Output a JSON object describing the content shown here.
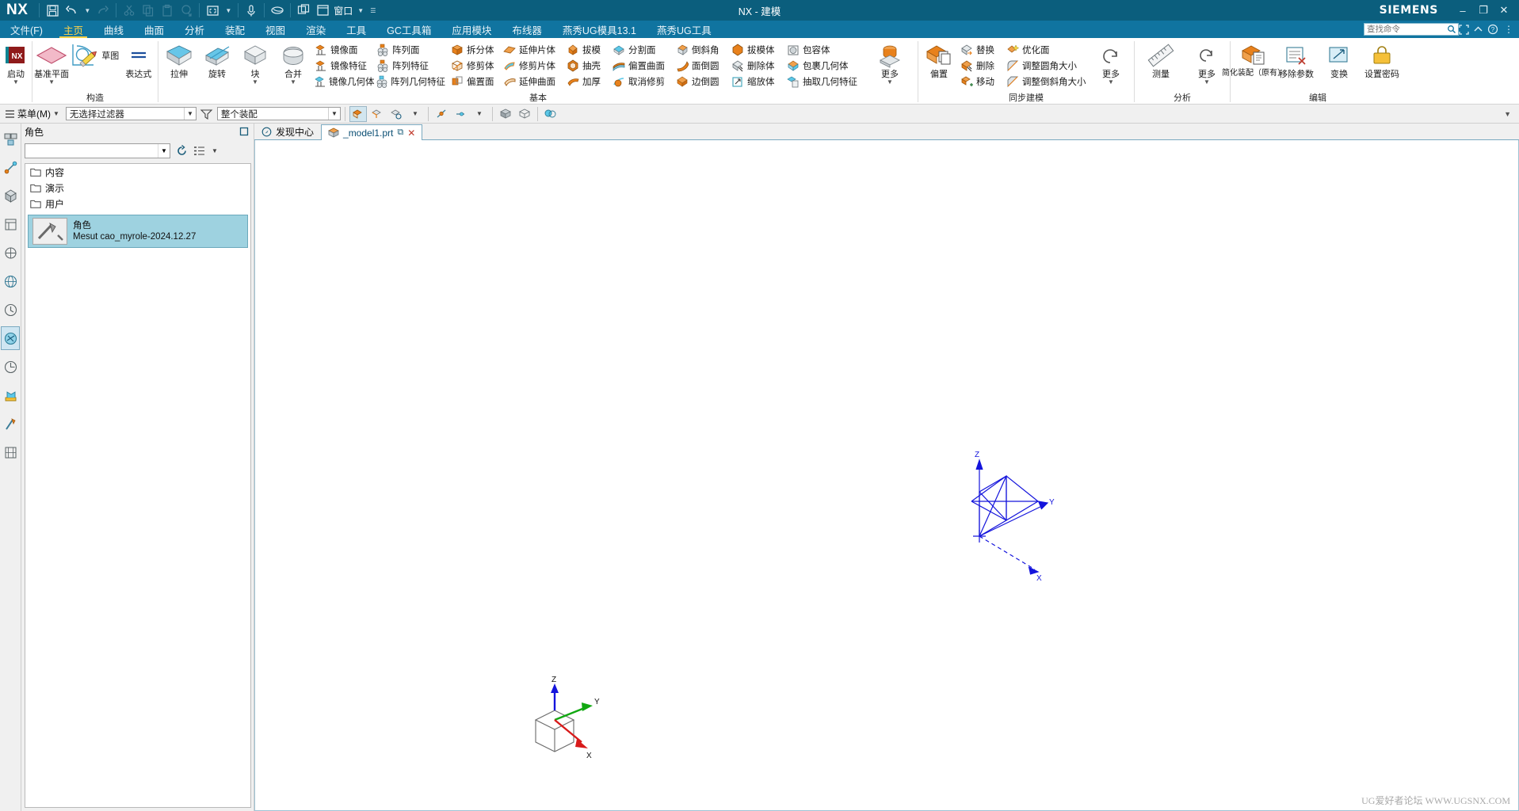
{
  "window": {
    "title": "NX - 建模",
    "brand": "SIEMENS",
    "logo": "NX",
    "controls": {
      "minimize": "–",
      "maximize": "❐",
      "close": "✕"
    }
  },
  "quickaccess": {
    "items": [
      {
        "name": "save-icon",
        "label": "保存"
      },
      {
        "name": "undo-icon",
        "label": "撤销"
      },
      {
        "name": "redo-icon",
        "label": "重做"
      },
      {
        "name": "cut-icon",
        "label": "剪切"
      },
      {
        "name": "copy-icon",
        "label": "复制"
      },
      {
        "name": "paste-icon",
        "label": "粘贴"
      },
      {
        "name": "transform-icon",
        "label": "变换"
      },
      {
        "name": "fit-window-icon",
        "label": "适合窗口"
      },
      {
        "name": "voice-icon",
        "label": "语音"
      },
      {
        "name": "eraser-icon",
        "label": "擦除"
      },
      {
        "name": "tile-windows-icon",
        "label": "平铺窗口"
      },
      {
        "name": "window-icon",
        "label": "窗口"
      }
    ],
    "window_label": "窗口"
  },
  "menubar": {
    "tabs": [
      {
        "label": "文件(F)",
        "active": false
      },
      {
        "label": "主页",
        "active": true
      },
      {
        "label": "曲线",
        "active": false
      },
      {
        "label": "曲面",
        "active": false
      },
      {
        "label": "分析",
        "active": false
      },
      {
        "label": "装配",
        "active": false
      },
      {
        "label": "视图",
        "active": false
      },
      {
        "label": "渲染",
        "active": false
      },
      {
        "label": "工具",
        "active": false
      },
      {
        "label": "GC工具箱",
        "active": false
      },
      {
        "label": "应用模块",
        "active": false
      },
      {
        "label": "布线器",
        "active": false
      },
      {
        "label": "燕秀UG模具13.1",
        "active": false
      },
      {
        "label": "燕秀UG工具",
        "active": false
      }
    ],
    "search": {
      "placeholder": "查找命令",
      "value": ""
    }
  },
  "ribbon": {
    "groups": [
      {
        "title": "",
        "big": [
          {
            "label": "启动",
            "icon": "nx-launch-icon",
            "dropdown": true
          }
        ]
      },
      {
        "title": "构造",
        "big": [
          {
            "label": "基准平面",
            "icon": "datum-plane-icon",
            "dropdown": true
          },
          {
            "label": "草图",
            "icon": "sketch-icon",
            "dropdown": false
          },
          {
            "label": "表达式",
            "icon": "expression-icon",
            "dropdown": false
          }
        ]
      },
      {
        "title": "基本",
        "big": [
          {
            "label": "拉伸",
            "icon": "extrude-icon",
            "dropdown": false
          },
          {
            "label": "旋转",
            "icon": "revolve-icon",
            "dropdown": false
          },
          {
            "label": "块",
            "icon": "block-icon",
            "dropdown": true
          },
          {
            "label": "合并",
            "icon": "unite-icon",
            "dropdown": true
          }
        ],
        "columns": [
          [
            {
              "label": "镜像面",
              "icon": "mirror-face-icon"
            },
            {
              "label": "镜像特征",
              "icon": "mirror-feature-icon"
            },
            {
              "label": "镜像几何体",
              "icon": "mirror-geometry-icon"
            }
          ],
          [
            {
              "label": "阵列面",
              "icon": "pattern-face-icon"
            },
            {
              "label": "阵列特征",
              "icon": "pattern-feature-icon"
            },
            {
              "label": "阵列几何特征",
              "icon": "pattern-geometry-icon"
            }
          ],
          [
            {
              "label": "拆分体",
              "icon": "split-body-icon"
            },
            {
              "label": "修剪体",
              "icon": "trim-body-icon"
            },
            {
              "label": "偏置面",
              "icon": "offset-face-icon"
            }
          ],
          [
            {
              "label": "延伸片体",
              "icon": "extend-sheet-icon"
            },
            {
              "label": "修剪片体",
              "icon": "trim-sheet-icon"
            },
            {
              "label": "延伸曲面",
              "icon": "extend-surface-icon"
            }
          ],
          [
            {
              "label": "拔模",
              "icon": "draft-icon"
            },
            {
              "label": "抽壳",
              "icon": "shell-icon"
            },
            {
              "label": "加厚",
              "icon": "thicken-icon"
            }
          ],
          [
            {
              "label": "分割面",
              "icon": "divide-face-icon"
            },
            {
              "label": "偏置曲面",
              "icon": "offset-surface-icon"
            },
            {
              "label": "取消修剪",
              "icon": "untrim-icon"
            }
          ],
          [
            {
              "label": "倒斜角",
              "icon": "chamfer-icon"
            },
            {
              "label": "面倒圆",
              "icon": "face-blend-icon"
            },
            {
              "label": "边倒圆",
              "icon": "edge-blend-icon"
            }
          ],
          [
            {
              "label": "拔模体",
              "icon": "draft-body-icon"
            },
            {
              "label": "删除体",
              "icon": "delete-body-icon"
            },
            {
              "label": "缩放体",
              "icon": "scale-body-icon"
            }
          ],
          [
            {
              "label": "包容体",
              "icon": "bounding-body-icon"
            },
            {
              "label": "包裹几何体",
              "icon": "wrap-geometry-icon"
            },
            {
              "label": "抽取几何特征",
              "icon": "extract-geometry-icon"
            }
          ]
        ],
        "more": {
          "label": "更多",
          "icon": "more-basic-icon",
          "dropdown": true
        }
      },
      {
        "title": "同步建模",
        "big": [
          {
            "label": "偏置",
            "icon": "offset-region-icon",
            "dropdown": false
          }
        ],
        "columns": [
          [
            {
              "label": "替换",
              "icon": "replace-face-icon"
            },
            {
              "label": "删除",
              "icon": "delete-face-icon"
            },
            {
              "label": "移动",
              "icon": "move-face-icon"
            }
          ],
          [
            {
              "label": "优化面",
              "icon": "optimize-face-icon"
            },
            {
              "label": "调整圆角大小",
              "icon": "resize-blend-icon"
            },
            {
              "label": "调整倒斜角大小",
              "icon": "resize-chamfer-icon"
            }
          ]
        ],
        "more": {
          "label": "更多",
          "icon": "more-sync-icon",
          "dropdown": true
        }
      },
      {
        "title": "分析",
        "big": [
          {
            "label": "测量",
            "icon": "measure-icon",
            "dropdown": false
          }
        ],
        "more": {
          "label": "更多",
          "icon": "more-analysis-icon",
          "dropdown": true
        }
      },
      {
        "title": "编辑",
        "big": [
          {
            "label": "简化装配（原有）",
            "icon": "simplify-assembly-icon",
            "dropdown": false
          },
          {
            "label": "移除参数",
            "icon": "remove-parameters-icon",
            "dropdown": false
          },
          {
            "label": "变换",
            "icon": "transform-edit-icon",
            "dropdown": false
          },
          {
            "label": "设置密码",
            "icon": "set-password-icon",
            "dropdown": false
          }
        ]
      }
    ]
  },
  "selection_bar": {
    "menu_label": "菜单(M)",
    "filter": {
      "value": "无选择过滤器",
      "placeholder": ""
    },
    "scope": {
      "value": "整个装配",
      "placeholder": ""
    },
    "icons": [
      {
        "name": "selection-filter-icon"
      },
      {
        "name": "select-face-icon",
        "active": true
      },
      {
        "name": "select-edge-icon"
      },
      {
        "name": "select-feature-icon"
      },
      {
        "name": "snap-point-icon"
      },
      {
        "name": "snap-options-icon"
      },
      {
        "name": "shaded-view-icon"
      },
      {
        "name": "wireframe-view-icon"
      },
      {
        "name": "render-style-icon"
      }
    ]
  },
  "resource_bar": {
    "items": [
      {
        "name": "assembly-navigator-icon",
        "selected": false
      },
      {
        "name": "constraint-navigator-icon",
        "selected": false
      },
      {
        "name": "part-navigator-icon",
        "selected": false
      },
      {
        "name": "reuse-library-icon",
        "selected": false
      },
      {
        "name": "hd3d-tools-icon",
        "selected": false
      },
      {
        "name": "web-browser-icon",
        "selected": false
      },
      {
        "name": "history-icon",
        "selected": false
      },
      {
        "name": "role-icon",
        "selected": true
      },
      {
        "name": "system-materials-icon",
        "selected": false
      },
      {
        "name": "process-studio-icon",
        "selected": false
      },
      {
        "name": "manufacturing-wizards-icon",
        "selected": false
      },
      {
        "name": "mold-wizard-icon",
        "selected": false
      },
      {
        "name": "electrode-design-icon",
        "selected": false
      }
    ]
  },
  "nav_panel": {
    "title": "角色",
    "pin": "pin-icon",
    "combo": {
      "value": "",
      "placeholder": ""
    },
    "toolbar_icons": [
      {
        "name": "refresh-roles-icon"
      },
      {
        "name": "role-options-icon"
      }
    ],
    "folders": [
      {
        "label": "内容",
        "icon": "folder-icon"
      },
      {
        "label": "演示",
        "icon": "folder-icon"
      },
      {
        "label": "用户",
        "icon": "folder-icon"
      }
    ],
    "selected_role": {
      "title": "角色",
      "subtitle": "Mesut cao_myrole-2024.12.27",
      "thumb": "role-thumbnail-icon"
    }
  },
  "tabs": [
    {
      "label": "发现中心",
      "icon": "discovery-center-icon",
      "active": false,
      "closable": false
    },
    {
      "label": "_model1.prt",
      "icon": "part-file-icon",
      "active": true,
      "closable": true,
      "close": "✕",
      "detach": "⧉"
    }
  ],
  "canvas": {
    "watermark": "UG爱好者论坛 WWW.UGSNX.COM",
    "wcs": {
      "x_label": "X",
      "y_label": "Y",
      "z_label": "Z",
      "color": "#1414dc"
    },
    "triad": {
      "x_label": "X",
      "y_label": "Y",
      "z_label": "Z",
      "x_color": "#d81a1a",
      "y_color": "#11a811",
      "z_color": "#1414dc"
    }
  },
  "colors": {
    "title_bg": "#0b5e7d",
    "menu_bg": "#1074a0",
    "accent": "#ffd24a",
    "panel_bg": "#f0f0f0",
    "selection": "#9ed2e0",
    "orange": "#e8811c",
    "blue_icon": "#2f86b8"
  }
}
